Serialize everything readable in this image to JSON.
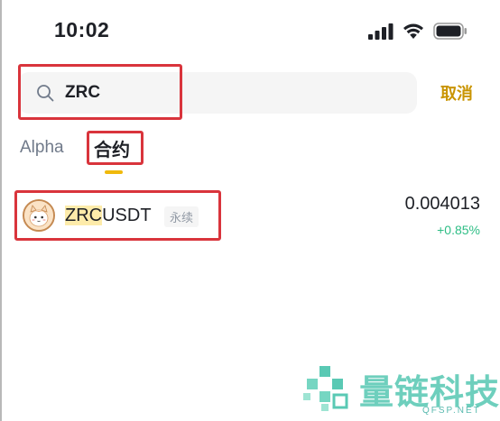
{
  "status_bar": {
    "time": "10:02"
  },
  "search": {
    "value": "ZRC",
    "placeholder": "",
    "cancel_label": "取消"
  },
  "tabs": [
    {
      "label": "Alpha",
      "active": false
    },
    {
      "label": "合约",
      "active": true
    }
  ],
  "results": [
    {
      "symbol_match": "ZRC",
      "symbol_rest": "USDT",
      "badge": "永续",
      "price": "0.004013",
      "change": "+0.85%"
    }
  ],
  "watermark": {
    "name": "量链科技",
    "site": "QFSP.NET"
  },
  "colors": {
    "accent": "#f0b90b",
    "cancel": "#c99400",
    "positive": "#2ebd85",
    "annotation": "#d9343c"
  },
  "icons": [
    "signal-icon",
    "wifi-icon",
    "battery-icon",
    "search-icon",
    "coin-avatar-icon"
  ]
}
